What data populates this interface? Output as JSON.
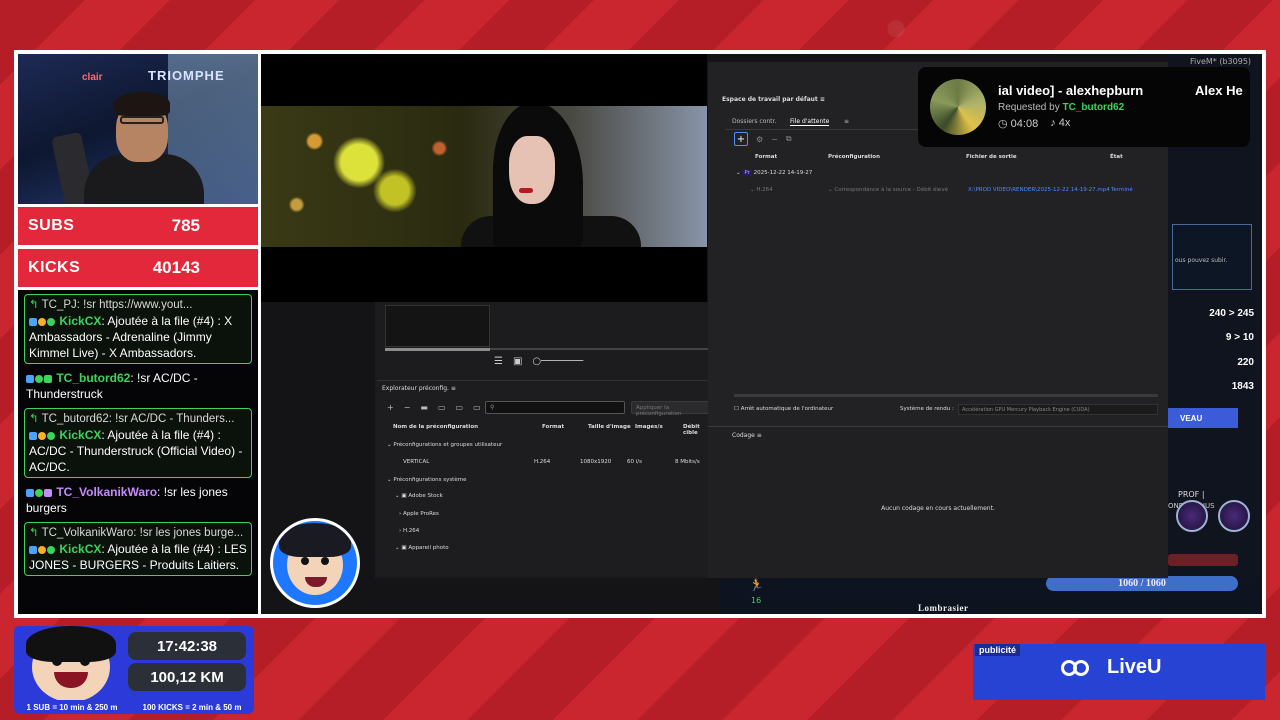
{
  "stats": {
    "subs_label": "SUBS",
    "subs_value": "785",
    "kicks_label": "KICKS",
    "kicks_value": "40143"
  },
  "webcam": {
    "sign": "TRIOMPHE",
    "lamp": "clair"
  },
  "chat": [
    {
      "reply": "TC_PJ: !sr https://www.yout...",
      "user": "KickCX",
      "text": ": Ajoutée à la file (#4) : X Ambassadors - Adrenaline (Jimmy Kimmel Live) - X Ambassadors.",
      "boxed": true
    },
    {
      "user": "TC_butord62",
      "text": ": !sr AC/DC - Thunderstruck",
      "boxed": false,
      "color": "green"
    },
    {
      "reply": "TC_butord62: !sr AC/DC - Thunders...",
      "user": "KickCX",
      "text": ": Ajoutée à la file (#4) : AC/DC - Thunderstruck (Official Video) - AC/DC.",
      "boxed": true
    },
    {
      "user": "TC_VolkanikWaro",
      "text": ": !sr les jones burgers",
      "boxed": false,
      "color": "violet"
    },
    {
      "reply": "TC_VolkanikWaro: !sr les jones burge...",
      "user": "KickCX",
      "text": ": Ajoutée à la file (#4) : LES JONES - BURGERS - Produits Laitiers.",
      "boxed": true
    }
  ],
  "song": {
    "title": "ial video] - alexhepburn",
    "artist": "Alex He",
    "requested_by_label": "Requested by",
    "requested_by": "TC_butord62",
    "duration": "04:08",
    "count": "4x"
  },
  "fivem": "FiveM* (b3095)",
  "premiere": {
    "workspace": "Espace de travail par défaut",
    "tabs": [
      "Dossiers contr.",
      "File d'attente"
    ],
    "queue_headers": [
      "Format",
      "Préconfiguration",
      "Fichier de sortie",
      "État"
    ],
    "queue_group": "2025-12-22 14-19-27",
    "queue_row": {
      "format": "H.264",
      "preset": "Correspondance à la source - Débit élevé",
      "output": "X:\\PROD VIDEO\\RENDER\\2025-12-22 14-19-27.mp4",
      "status": "Terminé"
    },
    "auto_shutdown": "Arrêt automatique de l'ordinateur",
    "render_system_label": "Système de rendu :",
    "render_system": "Accélération GPU Mercury Playback Engine (CUDA)",
    "codage_title": "Codage",
    "codage_empty": "Aucun codage en cours actuellement.",
    "explorer_title": "Explorateur préconfig.",
    "apply_button": "Appliquer la préconfiguration",
    "explorer_headers": [
      "Nom de la préconfiguration",
      "Format",
      "Taille d'image",
      "Images/s",
      "Débit cible"
    ],
    "explorer_rows": [
      {
        "name": "Préconfigurations et groupes utilisateur"
      },
      {
        "name": "VERTICAL",
        "format": "H.264",
        "size": "1080x1920",
        "fps": "60 i/s",
        "bitrate": "8 Mbits/s"
      },
      {
        "name": "Préconfigurations système"
      },
      {
        "name": "Adobe Stock"
      },
      {
        "name": "Apple ProRes"
      },
      {
        "name": "H.264"
      },
      {
        "name": "Appareil photo"
      }
    ]
  },
  "hud": {
    "partial": "ous pouvez subir.",
    "n1": "240 > 245",
    "n2": "9 > 10",
    "n3": "220",
    "n4": "1843",
    "niveau": "VEAU",
    "prof": "PROF |",
    "onet": "ONET DANUS",
    "hp": "1060 / 1060",
    "name": "Lombrasier",
    "runner_num": "16"
  },
  "timer": {
    "time": "17:42:38",
    "distance": "100,12 KM",
    "rule1": "1 SUB = 10 min & 250 m",
    "rule2": "100 KICKS = 2 min & 50 m"
  },
  "ad": {
    "tag": "publicité",
    "brand": "LiveU"
  },
  "colors": {
    "background_red": "#c8242c",
    "stat_red": "#e2283a",
    "chat_green": "#3cd45a",
    "timer_blue": "#2b3ad8",
    "ad_blue": "#2743d4"
  }
}
